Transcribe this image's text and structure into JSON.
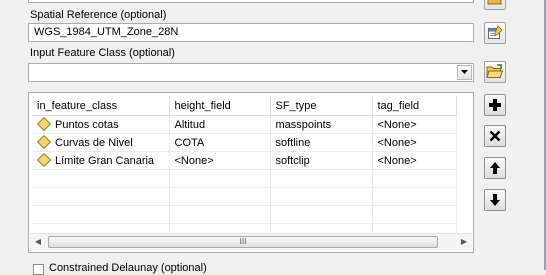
{
  "form": {
    "spatial_reference": {
      "label": "Spatial Reference (optional)",
      "value": "WGS_1984_UTM_Zone_28N"
    },
    "input_feature_class": {
      "label": "Input Feature Class (optional)",
      "value": ""
    },
    "table": {
      "columns": [
        "in_feature_class",
        "height_field",
        "SF_type",
        "tag_field"
      ],
      "rows": [
        {
          "in_feature_class": "Puntos cotas",
          "height_field": "Altitud",
          "SF_type": "masspoints",
          "tag_field": "<None>"
        },
        {
          "in_feature_class": "Curvas de Nivel",
          "height_field": "COTA",
          "SF_type": "softline",
          "tag_field": "<None>"
        },
        {
          "in_feature_class": "Límite Gran Canaria",
          "height_field": "<None>",
          "SF_type": "softclip",
          "tag_field": "<None>"
        }
      ],
      "scroll_grip": "III"
    },
    "constrained_delaunay": {
      "label": "Constrained Delaunay (optional)"
    }
  },
  "icons": {
    "folder": "open-folder-icon",
    "properties": "spatial-reference-properties-icon",
    "add": "add-plus-icon",
    "remove": "remove-x-icon",
    "up": "move-up-arrow-icon",
    "down": "move-down-arrow-icon"
  }
}
